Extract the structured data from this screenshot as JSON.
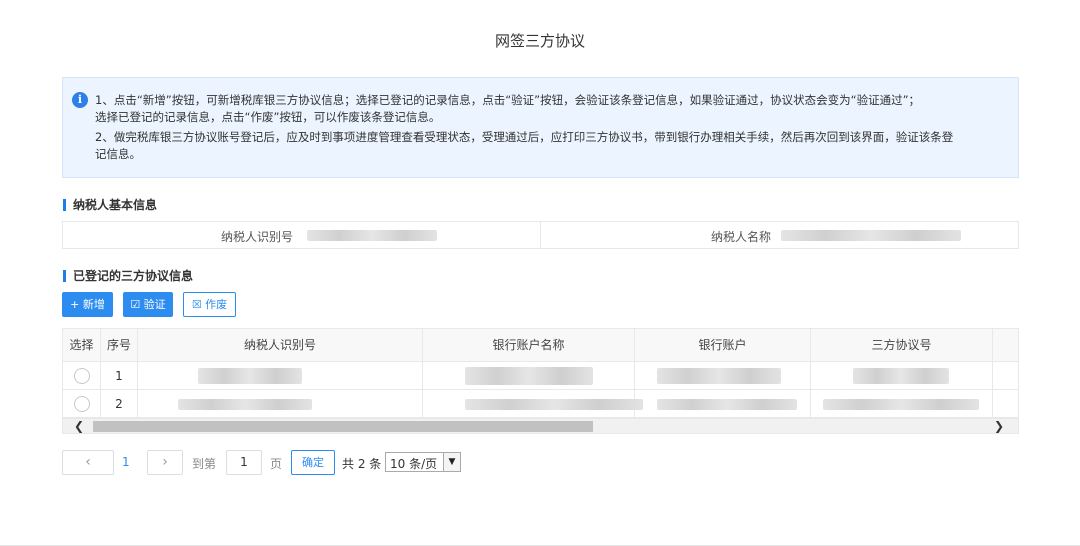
{
  "page": {
    "title": "网签三方协议"
  },
  "notice": {
    "icon": "info-icon",
    "line1": "1、点击“新增”按钮，可新增税库银三方协议信息；选择已登记的记录信息，点击“验证”按钮，会验证该条登记信息，如果验证通过，协议状态会变为“验证通过”；",
    "line2": "选择已登记的记录信息，点击“作废”按钮，可以作废该条登记信息。",
    "line3": "2、做完税库银三方协议账号登记后，应及时到事项进度管理查看受理状态，受理通过后，应打印三方协议书，带到银行办理相关手续，然后再次回到该界面，验证该条登",
    "line4": "记信息。"
  },
  "taxpayer_section": {
    "title": "纳税人基本信息",
    "id_label": "纳税人识别号",
    "name_label": "纳税人名称"
  },
  "agreements_section": {
    "title": "已登记的三方协议信息",
    "buttons": {
      "add": "+ 新增",
      "verify": "☑ 验证",
      "void": "☒ 作废"
    },
    "columns": [
      "选择",
      "序号",
      "纳税人识别号",
      "银行账户名称",
      "银行账户",
      "三方协议号"
    ],
    "rows": [
      {
        "index": "1"
      },
      {
        "index": "2"
      }
    ]
  },
  "pagination": {
    "prev": "‹",
    "current_page": "1",
    "next": "›",
    "goto_label": "到第",
    "goto_value": "1",
    "page_unit": "页",
    "confirm": "确定",
    "total": "共 2 条",
    "page_size": "10 条/页"
  },
  "colors": {
    "accent": "#2d8cf0",
    "notice_bg": "#ebf4ff",
    "section_bar": "#1f7de6"
  }
}
